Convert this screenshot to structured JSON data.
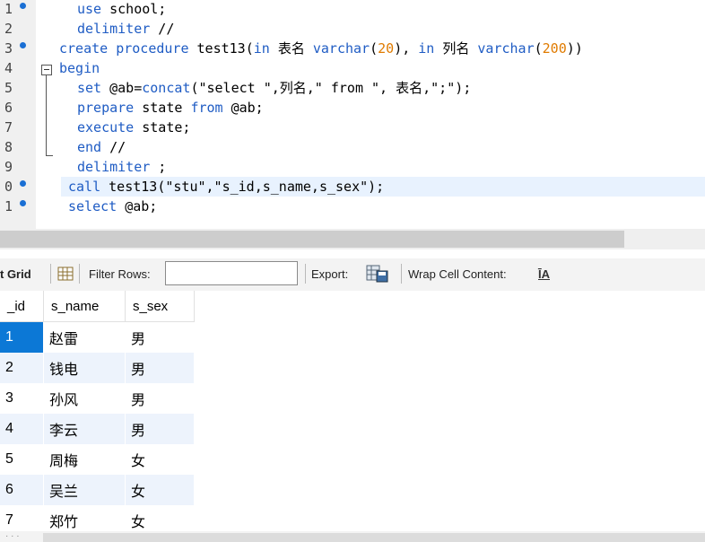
{
  "editor": {
    "lines": [
      {
        "num": "1",
        "dot": true,
        "indent": 86,
        "tokens": [
          {
            "t": "use",
            "c": "kw"
          },
          {
            "t": " school;"
          }
        ]
      },
      {
        "num": "2",
        "dot": false,
        "indent": 86,
        "tokens": [
          {
            "t": "delimiter",
            "c": "kw"
          },
          {
            "t": " //"
          }
        ]
      },
      {
        "num": "3",
        "dot": true,
        "indent": 66,
        "tokens": [
          {
            "t": "create procedure",
            "c": "kw"
          },
          {
            "t": " test13("
          },
          {
            "t": "in",
            "c": "kw"
          },
          {
            "t": " 表名 "
          },
          {
            "t": "varchar",
            "c": "kw"
          },
          {
            "t": "("
          },
          {
            "t": "20",
            "c": "num"
          },
          {
            "t": "), "
          },
          {
            "t": "in",
            "c": "kw"
          },
          {
            "t": " 列名 "
          },
          {
            "t": "varchar",
            "c": "kw"
          },
          {
            "t": "("
          },
          {
            "t": "200",
            "c": "num"
          },
          {
            "t": "))"
          }
        ]
      },
      {
        "num": "4",
        "dot": false,
        "indent": 66,
        "tokens": [
          {
            "t": "begin",
            "c": "kw"
          }
        ]
      },
      {
        "num": "5",
        "dot": false,
        "indent": 86,
        "tokens": [
          {
            "t": "set",
            "c": "kw"
          },
          {
            "t": " @ab="
          },
          {
            "t": "concat",
            "c": "kw"
          },
          {
            "t": "(\"select \",列名,\" from \", 表名,\";\");"
          }
        ]
      },
      {
        "num": "6",
        "dot": false,
        "indent": 86,
        "tokens": [
          {
            "t": "prepare",
            "c": "kw"
          },
          {
            "t": " state "
          },
          {
            "t": "from",
            "c": "kw"
          },
          {
            "t": " @ab;"
          }
        ]
      },
      {
        "num": "7",
        "dot": false,
        "indent": 86,
        "tokens": [
          {
            "t": "execute",
            "c": "kw"
          },
          {
            "t": " state;"
          }
        ]
      },
      {
        "num": "8",
        "dot": false,
        "indent": 86,
        "tokens": [
          {
            "t": "end",
            "c": "kw"
          },
          {
            "t": " //"
          }
        ]
      },
      {
        "num": "9",
        "dot": false,
        "indent": 86,
        "tokens": [
          {
            "t": "delimiter",
            "c": "kw"
          },
          {
            "t": " ;"
          }
        ]
      },
      {
        "num": "0",
        "dot": true,
        "indent": 76,
        "highlight": true,
        "tokens": [
          {
            "t": "call",
            "c": "kw"
          },
          {
            "t": " test13(\"stu\",\"s_id,s_name,s_sex\");"
          }
        ]
      },
      {
        "num": "1",
        "dot": true,
        "indent": 76,
        "tokens": [
          {
            "t": "select",
            "c": "kw"
          },
          {
            "t": " @ab;"
          }
        ]
      }
    ]
  },
  "toolbar": {
    "result_grid_label": "t Grid",
    "filter_rows_label": "Filter Rows:",
    "filter_value": "",
    "export_label": "Export:",
    "wrap_label": "Wrap Cell Content:",
    "wrap_icon": "ĪA"
  },
  "grid": {
    "columns": [
      "_id",
      "s_name",
      "s_sex"
    ],
    "rows": [
      [
        "1",
        "赵雷",
        "男"
      ],
      [
        "2",
        "钱电",
        "男"
      ],
      [
        "3",
        "孙风",
        "男"
      ],
      [
        "4",
        "李云",
        "男"
      ],
      [
        "5",
        "周梅",
        "女"
      ],
      [
        "6",
        "吴兰",
        "女"
      ],
      [
        "7",
        "郑竹",
        "女"
      ]
    ]
  },
  "colors": {
    "keyword": "#1f5cc4",
    "number": "#e07b00",
    "selection": "#0c78d6",
    "alt_row": "#edf3fc"
  }
}
